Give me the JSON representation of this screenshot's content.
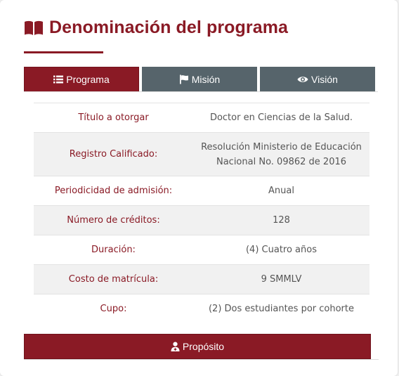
{
  "section": {
    "title": "Denominación del programa",
    "icon": "book-open-icon"
  },
  "tabs": [
    {
      "label": "Programa",
      "icon": "list-icon",
      "active": true
    },
    {
      "label": "Misión",
      "icon": "flag-icon",
      "active": false
    },
    {
      "label": "Visión",
      "icon": "eye-icon",
      "active": false
    }
  ],
  "info_rows": [
    {
      "label": "Título a otorgar",
      "value_lines": [
        "Doctor en Ciencias de la Salud."
      ]
    },
    {
      "label": "Registro Calificado:",
      "value_lines": [
        "Resolución Ministerio de Educación",
        "Nacional No. 09862 de 2016"
      ]
    },
    {
      "label": "Periodicidad de admisión:",
      "value_lines": [
        "Anual"
      ]
    },
    {
      "label": "Número de créditos:",
      "value_lines": [
        "128"
      ]
    },
    {
      "label": "Duración:",
      "value_lines": [
        "(4) Cuatro años"
      ]
    },
    {
      "label": "Costo de matrícula:",
      "value_lines": [
        "9 SMMLV"
      ]
    },
    {
      "label": "Cupo:",
      "value_lines": [
        "(2) Dos estudiantes por cohorte"
      ]
    }
  ],
  "proposito_button": {
    "label": "Propósito",
    "icon": "user-doctor-icon"
  },
  "colors": {
    "brand": "#8a1a25",
    "tab_inactive": "#56646b",
    "row_alt": "#f1f1f1",
    "value_text": "#555555"
  }
}
